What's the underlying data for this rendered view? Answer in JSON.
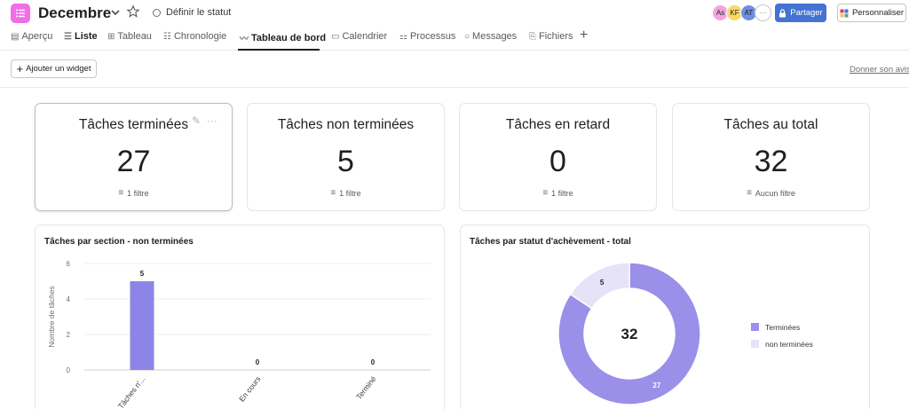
{
  "header": {
    "project_title": "Decembre",
    "status_label": "Définir le statut",
    "avatars": [
      {
        "initials": "As",
        "color": "#f5a3e0"
      },
      {
        "initials": "KF",
        "color": "#f8d86b"
      },
      {
        "initials": "AT",
        "color": "#6f8fe0"
      }
    ],
    "more_label": "···",
    "share_label": "Partager",
    "customize_label": "Personnaliser"
  },
  "tabs": [
    {
      "label": "Aperçu",
      "icon": "overview-icon"
    },
    {
      "label": "Liste",
      "icon": "list-icon"
    },
    {
      "label": "Tableau",
      "icon": "board-icon"
    },
    {
      "label": "Chronologie",
      "icon": "timeline-icon"
    },
    {
      "label": "Tableau de bord",
      "icon": "dashboard-icon"
    },
    {
      "label": "Calendrier",
      "icon": "calendar-icon"
    },
    {
      "label": "Processus",
      "icon": "workflow-icon"
    },
    {
      "label": "Messages",
      "icon": "message-icon"
    },
    {
      "label": "Fichiers",
      "icon": "file-icon"
    }
  ],
  "active_tab": "Tableau de bord",
  "toolbar": {
    "add_widget_label": "Ajouter un widget",
    "feedback_label": "Donner son avis"
  },
  "kpis": [
    {
      "title": "Tâches terminées",
      "value": "27",
      "filter": "1 filtre"
    },
    {
      "title": "Tâches non terminées",
      "value": "5",
      "filter": "1 filtre"
    },
    {
      "title": "Tâches en retard",
      "value": "0",
      "filter": "1 filtre"
    },
    {
      "title": "Tâches au total",
      "value": "32",
      "filter": "Aucun filtre"
    }
  ],
  "chart_data": [
    {
      "type": "bar",
      "title": "Tâches par section - non terminées",
      "ylabel": "Nombre de tâches",
      "xlabel": "",
      "categories": [
        "Tâches n'...",
        "En cours",
        "Terminé"
      ],
      "values": [
        5,
        0,
        0
      ],
      "ylim": [
        0,
        6
      ],
      "yticks": [
        0,
        2,
        4,
        6
      ],
      "grid": true,
      "color": "#8d84e8"
    },
    {
      "type": "pie",
      "title": "Tâches par statut d'achèvement - total",
      "center_label": "32",
      "slices": [
        {
          "name": "Terminées",
          "value": 27,
          "color": "#9a8fe9"
        },
        {
          "name": "non terminées",
          "value": 5,
          "color": "#e6e2f7"
        }
      ],
      "legend": "right"
    }
  ]
}
